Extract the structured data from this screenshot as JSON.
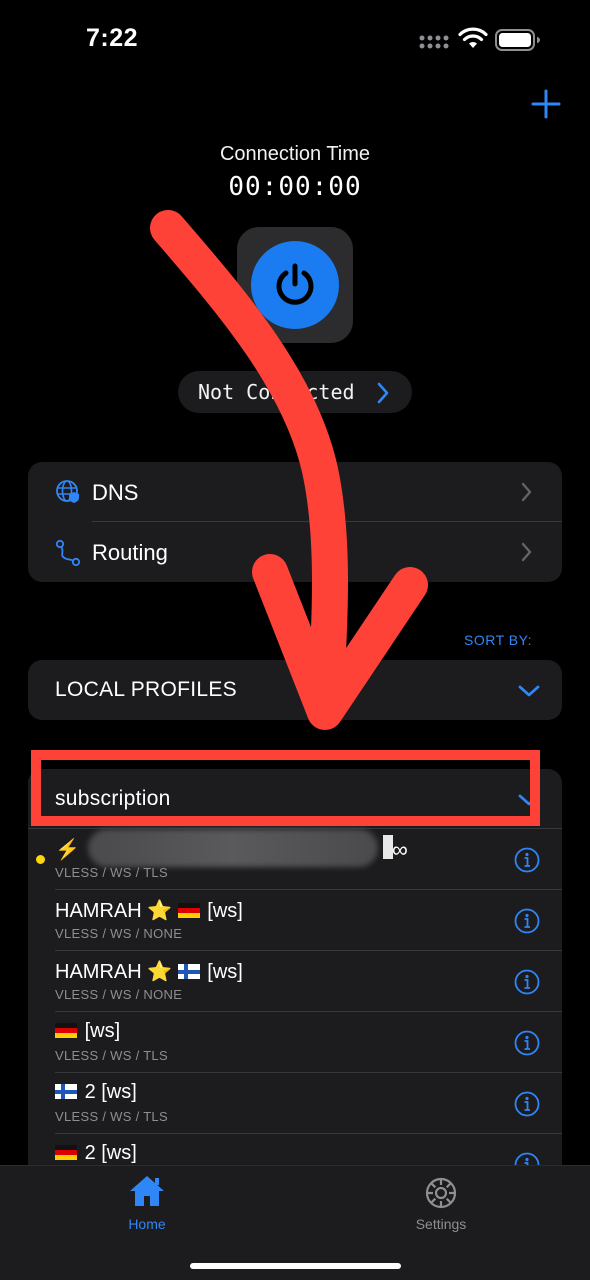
{
  "status_bar": {
    "time": "7:22"
  },
  "connection": {
    "title": "Connection Time",
    "timer": "00:00:00",
    "status": "Not Connected"
  },
  "settings_rows": [
    {
      "label": "DNS",
      "icon": "globe-shield-icon"
    },
    {
      "label": "Routing",
      "icon": "routing-path-icon"
    }
  ],
  "sort_by_label": "SORT BY:",
  "local_group": {
    "label": "LOCAL PROFILES"
  },
  "subscription_group": {
    "label": "subscription"
  },
  "profiles": [
    {
      "title_prefix": "⚡",
      "title_suffix": "∞",
      "subtitle": "VLESS / WS / TLS",
      "active": true
    },
    {
      "title_before": "HAMRAH ⭐",
      "flag": "de",
      "title_after": "[ws]",
      "subtitle": "VLESS / WS / NONE"
    },
    {
      "title_before": "HAMRAH ⭐",
      "flag": "fi",
      "title_after": "[ws]",
      "subtitle": "VLESS / WS / NONE"
    },
    {
      "title_before": "",
      "flag": "de",
      "title_after": "[ws]",
      "subtitle": "VLESS / WS / TLS"
    },
    {
      "title_before": "",
      "flag": "fi",
      "title_after": "2 [ws]",
      "subtitle": "VLESS / WS / TLS"
    },
    {
      "title_before": "",
      "flag": "de",
      "title_after": "2 [ws]",
      "subtitle": ""
    }
  ],
  "tabs": [
    {
      "label": "Home",
      "icon": "home-icon",
      "selected": true
    },
    {
      "label": "Settings",
      "icon": "gear-icon",
      "selected": false
    }
  ],
  "colors": {
    "accent": "#2f86f6",
    "power": "#1a7cf0",
    "annotation": "#ff4238",
    "active_dot": "#ffd60a"
  }
}
